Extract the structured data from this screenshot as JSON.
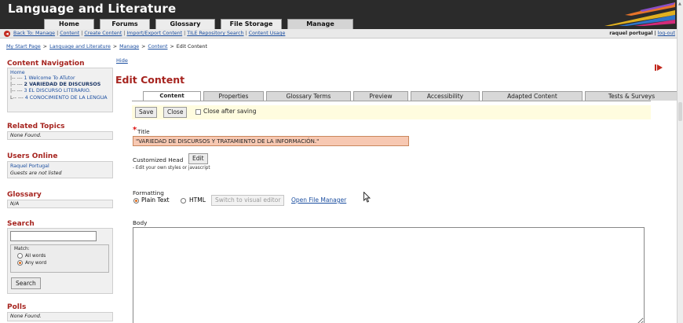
{
  "site": {
    "title": "Language and Literature"
  },
  "main_tabs": [
    {
      "label": "Home",
      "w": 64
    },
    {
      "label": "Forums",
      "w": 64
    },
    {
      "label": "Glossary",
      "w": 76
    },
    {
      "label": "File Storage",
      "w": 78
    },
    {
      "label": "Manage",
      "w": 84,
      "active": true
    }
  ],
  "subnav": {
    "links": [
      "Back To: Manage",
      "Content",
      "Create Content",
      "Import/Export Content",
      "TILE Repository Search",
      "Content Usage"
    ],
    "user_name": "raquel portugal",
    "separator": "|",
    "logout": "log-out"
  },
  "breadcrumb": {
    "items": [
      "My Start Page",
      "Language and Literature",
      "Manage",
      "Content"
    ],
    "separator": ">",
    "current": "Edit Content"
  },
  "sidebar": {
    "content_navigation": {
      "heading": "Content Navigation",
      "hide_link": "Hide",
      "home": "Home",
      "items": [
        {
          "prefix": "|-- --- ",
          "label": "1 Welcome To ATutor"
        },
        {
          "prefix": "|-- --- ",
          "label": "2 VARIEDAD DE DISCURSOS",
          "current": true
        },
        {
          "prefix": "|-- --- ",
          "label": "3 EL DISCURSO LITERARIO."
        },
        {
          "prefix": "L-- --- ",
          "label": "4 CONOCIMIENTO DE LA LENGUA"
        }
      ]
    },
    "related_topics": {
      "heading": "Related Topics",
      "text": "None Found."
    },
    "users_online": {
      "heading": "Users Online",
      "user": "Raquel Portugal",
      "guests": "Guests are not listed"
    },
    "glossary": {
      "heading": "Glossary",
      "text": "N/A"
    },
    "search": {
      "heading": "Search",
      "input_value": "",
      "match_label": "Match:",
      "options": [
        {
          "label": "All words",
          "checked": false
        },
        {
          "label": "Any word",
          "checked": true
        }
      ],
      "button": "Search"
    },
    "polls": {
      "heading": "Polls",
      "text": "None Found."
    }
  },
  "main": {
    "page_title": "Edit Content",
    "tabs": [
      {
        "label": "Content",
        "w": 74,
        "active": true
      },
      {
        "label": "Properties",
        "w": 77
      },
      {
        "label": "Glossary Terms",
        "w": 108
      },
      {
        "label": "Preview",
        "w": 70
      },
      {
        "label": "Accessibility",
        "w": 88
      },
      {
        "label": "Adapted Content",
        "w": 128
      },
      {
        "label": "Tests & Surveys",
        "w": 119
      }
    ],
    "save_button": "Save",
    "close_button": "Close",
    "close_after_saving": "Close after saving",
    "required_marker": "*",
    "title_label": "Title",
    "title_value": "\"VARIEDAD DE DISCURSOS Y TRATAMIENTO DE LA INFORMACIÓN.\"",
    "customized_head_label": "Customized Head",
    "edit_button": "Edit",
    "customized_hint": "- Edit your own styles or javascript",
    "formatting_label": "Formatting",
    "format_options": {
      "plain": "Plain Text",
      "html": "HTML",
      "selected": "Plain Text"
    },
    "visual_editor_button": "Switch to visual editor",
    "file_manager_link": "Open File Manager",
    "body_label": "Body",
    "body_value": ""
  },
  "colors": {
    "header_bg": "#2b2b2b",
    "heading_red": "#a6241f",
    "link_blue": "#1c4fa0",
    "title_field_bg": "#f7c8b2",
    "save_bar_bg": "#fffcdf"
  },
  "icons": {
    "back": "back-circle-icon",
    "pencils": "colored-pencils-logo",
    "collapse": "arrow-right-icon",
    "cursor": "mouse-cursor-icon"
  }
}
